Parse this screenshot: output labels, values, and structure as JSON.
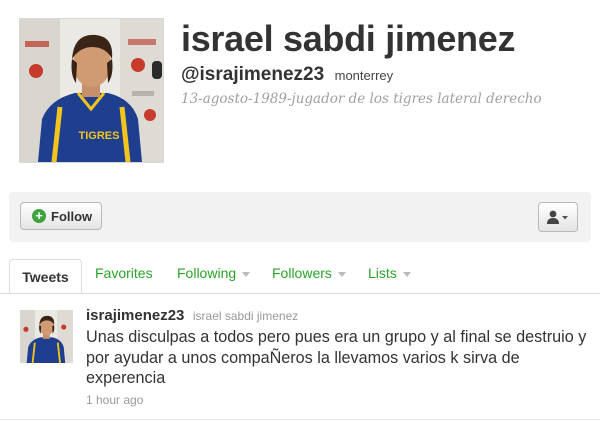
{
  "profile": {
    "name": "israel sabdi jimenez",
    "screen_name": "@israjimenez23",
    "location": "monterrey",
    "bio": "13-agosto-1989-jugador de los tigres lateral derecho",
    "avatar_icon": "profile-photo-soccer-player",
    "avatar_jersey_text": "TIGRES"
  },
  "actions": {
    "follow_label": "Follow",
    "follow_icon": "plus-circle-icon",
    "user_menu_icon": "user-silhouette-icon"
  },
  "tabs": [
    {
      "label": "Tweets",
      "active": true,
      "dropdown": false
    },
    {
      "label": "Favorites",
      "active": false,
      "dropdown": false
    },
    {
      "label": "Following",
      "active": false,
      "dropdown": true
    },
    {
      "label": "Followers",
      "active": false,
      "dropdown": true
    },
    {
      "label": "Lists",
      "active": false,
      "dropdown": true
    }
  ],
  "tweet": {
    "screen_name": "israjimenez23",
    "full_name": "israel sabdi jimenez",
    "text": "Unas disculpas a todos pero pues era un grupo y al final se destruio y por ayudar a unos compaÑeros la llevamos varios k sirva de experencia",
    "time": "1 hour ago"
  },
  "colors": {
    "link_green": "#2aa32a",
    "plus_green": "#3fa33f",
    "bio_gray": "#a0a0a0",
    "action_bar_bg": "#f2f2f2",
    "jersey_blue": "#1e3f8f",
    "jersey_gold": "#f2c41c"
  }
}
